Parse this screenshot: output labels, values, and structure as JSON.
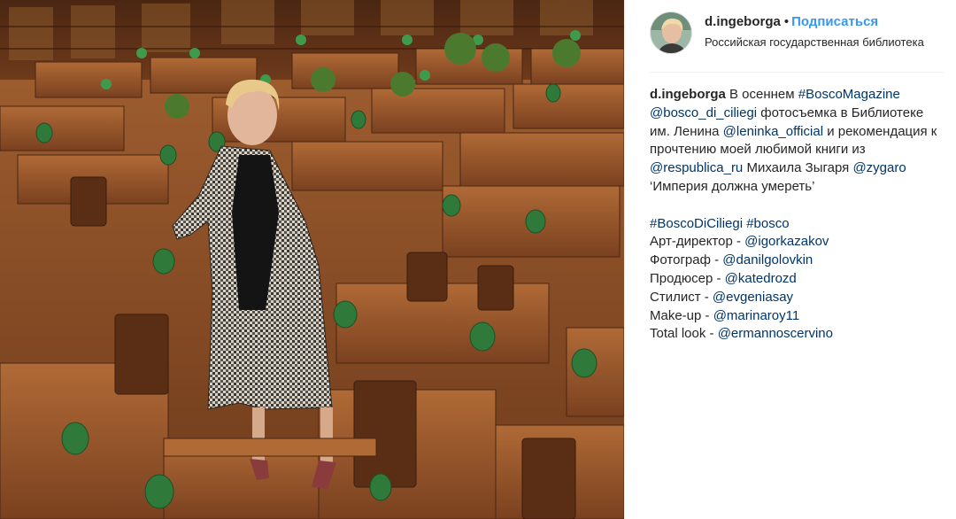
{
  "header": {
    "username": "d.ingeborga",
    "separator": "•",
    "follow_label": "Подписаться",
    "location": "Российская государственная библиотека"
  },
  "caption": {
    "username": "d.ingeborga",
    "t1": " В осеннем ",
    "tag_bosco_magazine": "#BoscoMagazine",
    "mention_bosco_di_ciliegi": "@bosco_di_ciliegi",
    "t2": " фотосъемка в Библиотеке им. Ленина ",
    "mention_leninka": "@leninka_official",
    "t3": " и рекомендация к прочтению моей любимой книги из ",
    "mention_respublica": "@respublica_ru",
    "t4": " Михаила Зыгаря ",
    "mention_zygaro": "@zygaro",
    "t5": " ‘Империя должна умереть’",
    "tag_bosco_di_ciliegi": "#BoscoDiCiliegi",
    "tag_space": " ",
    "tag_bosco": "#bosco",
    "credits": [
      {
        "role": "Арт-директор - ",
        "handle": "@igorkazakov"
      },
      {
        "role": "Фотограф - ",
        "handle": "@danilgolovkin"
      },
      {
        "role": "Продюсер - ",
        "handle": "@katedrozd"
      },
      {
        "role": "Стилист - ",
        "handle": "@evgeniasay"
      },
      {
        "role": "Make-up - ",
        "handle": "@marinaroy11"
      },
      {
        "role": "Total look - ",
        "handle": "@ermannoscervino"
      }
    ]
  },
  "colors": {
    "link": "#003569",
    "follow": "#3897f0",
    "text": "#262626",
    "divider": "#efefef"
  }
}
